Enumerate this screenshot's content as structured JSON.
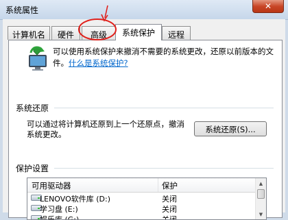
{
  "window": {
    "title": "系统属性",
    "close_glyph": "✕"
  },
  "tabs": [
    {
      "label": "计算机名",
      "active": false
    },
    {
      "label": "硬件",
      "active": false
    },
    {
      "label": "高级",
      "active": false
    },
    {
      "label": "系统保护",
      "active": true
    },
    {
      "label": "远程",
      "active": false
    }
  ],
  "intro": {
    "text": "可以使用系统保护来撤消不需要的系统更改，还原以前版本的文件。",
    "link": "什么是系统保护?"
  },
  "system_restore": {
    "heading": "系统还原",
    "description": "可以通过将计算机还原到上一个还原点，撤消系统更改。",
    "button_label": "系统还原(S)..."
  },
  "protection": {
    "heading": "保护设置",
    "columns": [
      "可用驱动器",
      "保护"
    ],
    "rows": [
      {
        "drive": "LENOVO软件库 (D:)",
        "state": "关闭"
      },
      {
        "drive": "学习盘 (E:)",
        "state": "关闭"
      },
      {
        "drive": "娱乐库 (G:)",
        "state": "关闭"
      }
    ]
  },
  "annotation": {
    "color": "#e0201b",
    "targets": "tab-advanced"
  },
  "colors": {
    "link": "#0066cc",
    "close_button": "#c84526",
    "window_frame": "#cfdbe9"
  },
  "icons": [
    "shield-restore-icon",
    "drive-icon",
    "scroll-up-icon",
    "scroll-down-icon"
  ]
}
